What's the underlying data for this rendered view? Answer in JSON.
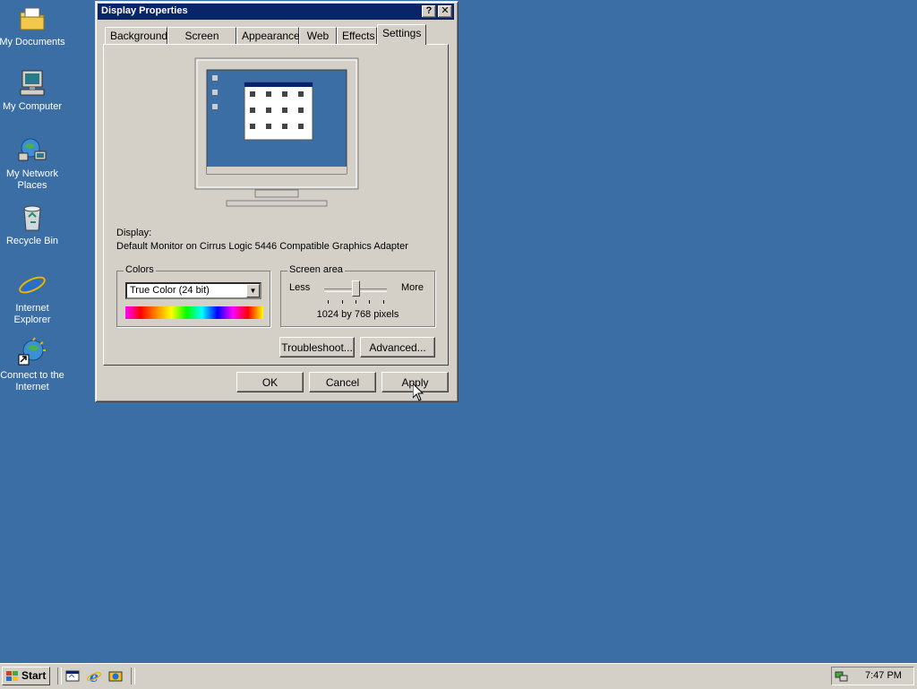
{
  "desktop": {
    "icons": [
      {
        "label": "My Documents",
        "icon": "folder-icon"
      },
      {
        "label": "My Computer",
        "icon": "computer-icon"
      },
      {
        "label": "My Network Places",
        "icon": "network-icon"
      },
      {
        "label": "Recycle Bin",
        "icon": "recycle-bin-icon"
      },
      {
        "label": "Internet Explorer",
        "icon": "ie-icon"
      },
      {
        "label": "Connect to the Internet",
        "icon": "connect-icon"
      }
    ]
  },
  "dialog": {
    "title": "Display Properties",
    "help_glyph": "?",
    "close_glyph": "✕",
    "tabs": [
      "Background",
      "Screen Saver",
      "Appearance",
      "Web",
      "Effects",
      "Settings"
    ],
    "active_tab": "Settings",
    "display_label": "Display:",
    "display_value": "Default Monitor on Cirrus Logic 5446 Compatible Graphics Adapter",
    "colors": {
      "legend": "Colors",
      "selected": "True Color (24 bit)"
    },
    "screen_area": {
      "legend": "Screen area",
      "less": "Less",
      "more": "More",
      "value": "1024 by 768 pixels",
      "slider_fraction": 0.5
    },
    "troubleshoot": "Troubleshoot...",
    "advanced": "Advanced...",
    "ok": "OK",
    "cancel": "Cancel",
    "apply": "Apply"
  },
  "taskbar": {
    "start": "Start",
    "clock": "7:47 PM"
  },
  "colors": {
    "desktop": "#3a6ea5",
    "titlebar": "#0a246a",
    "face": "#d4d0c8"
  }
}
